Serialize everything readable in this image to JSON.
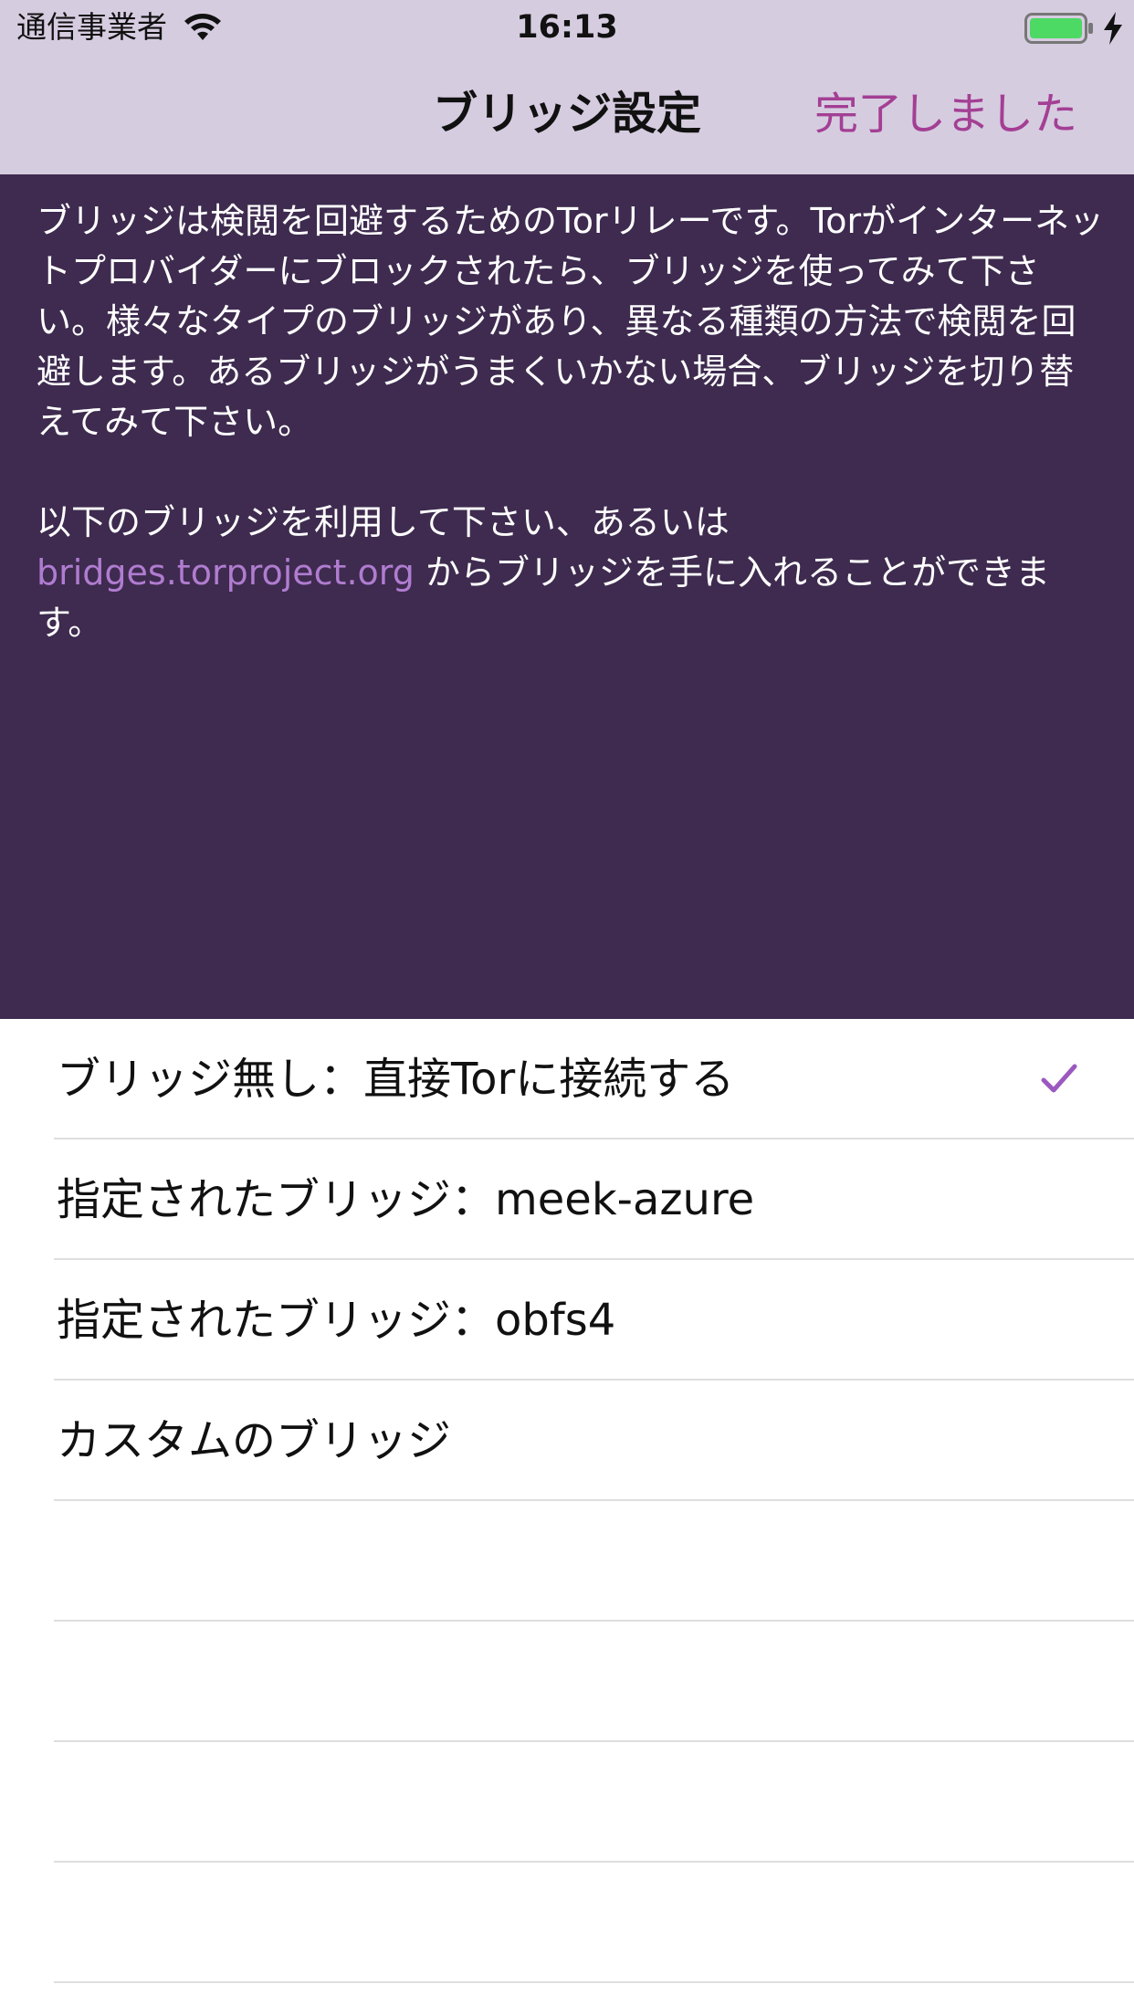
{
  "status_bar": {
    "carrier": "通信事業者",
    "time": "16:13",
    "wifi_icon": "wifi-icon",
    "battery_icon": "battery-icon",
    "charging_icon": "bolt-icon",
    "battery_color": "#4cd964"
  },
  "nav": {
    "title": "ブリッジ設定",
    "done_label": "完了しました",
    "done_color": "#a33f94"
  },
  "description": {
    "paragraph1": "ブリッジは検閲を回避するためのTorリレーです。Torがインターネットプロバイダーにブロックされたら、ブリッジを使ってみて下さい。様々なタイプのブリッジがあり、異なる種類の方法で検閲を回避します。あるブリッジがうまくいかない場合、ブリッジを切り替えてみて下さい。",
    "paragraph2_before": "以下のブリッジを利用して下さい、あるいは",
    "link": "bridges.torproject.org",
    "paragraph2_after": " からブリッジを手に入れることができます。",
    "background_color": "#3e2b4f",
    "link_color": "#b07cd0"
  },
  "bridges": {
    "options": [
      {
        "label": "ブリッジ無し：直接Torに接続する",
        "selected": true
      },
      {
        "label": "指定されたブリッジ：meek-azure",
        "selected": false
      },
      {
        "label": "指定されたブリッジ：obfs4",
        "selected": false
      },
      {
        "label": "カスタムのブリッジ",
        "selected": false
      }
    ],
    "checkmark_icon": "checkmark-icon",
    "checkmark_color": "#9b59c0"
  }
}
